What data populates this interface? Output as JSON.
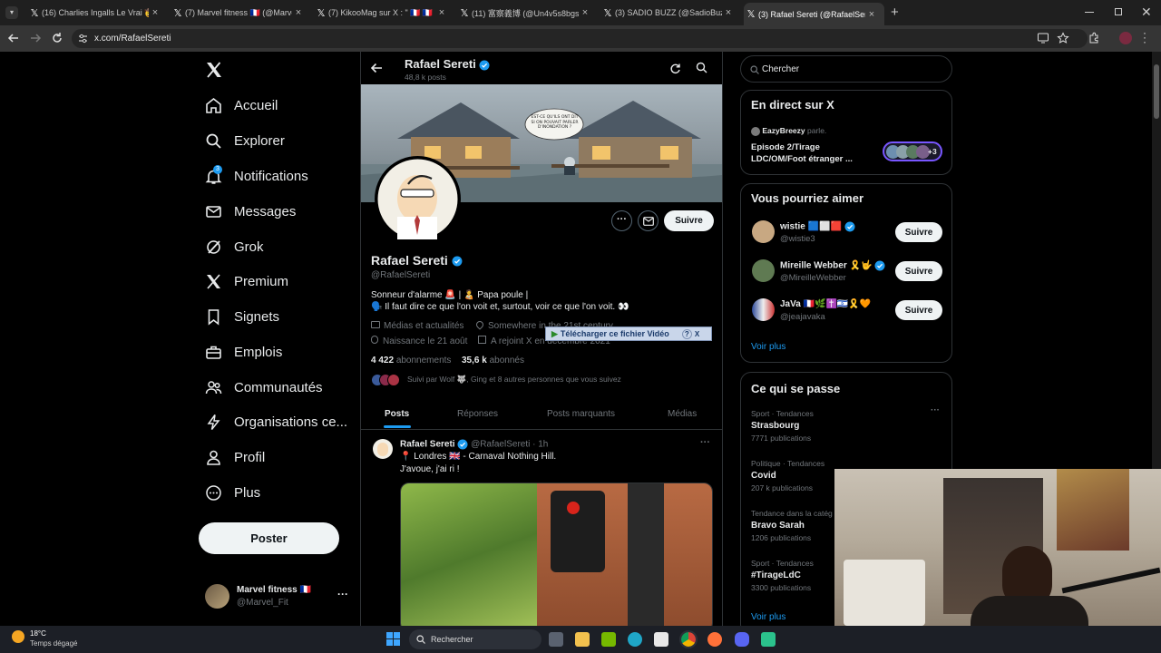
{
  "browser": {
    "tabs": [
      {
        "title": "(16) Charlies Ingalls Le Vrai 🤠 ’"
      },
      {
        "title": "(7) Marvel fitness 🇫🇷 (@Marvel_"
      },
      {
        "title": "(7) KikooMag sur X : \" 🇫🇷 🇫🇷 | U"
      },
      {
        "title": "(11) 富察義博 (@Un4v5s8bgsVI"
      },
      {
        "title": "(3) SADIO BUZZ (@SadioBuzz)"
      },
      {
        "title": "(3) Rafael Sereti (@RafaelSereti"
      }
    ],
    "url": "x.com/RafaelSereti"
  },
  "sidebar": {
    "items": [
      {
        "label": "Accueil",
        "icon": "home-icon"
      },
      {
        "label": "Explorer",
        "icon": "search-icon"
      },
      {
        "label": "Notifications",
        "icon": "bell-icon",
        "badge": "3"
      },
      {
        "label": "Messages",
        "icon": "mail-icon"
      },
      {
        "label": "Grok",
        "icon": "grok-icon"
      },
      {
        "label": "Premium",
        "icon": "x-logo-icon"
      },
      {
        "label": "Signets",
        "icon": "bookmark-icon"
      },
      {
        "label": "Emplois",
        "icon": "briefcase-icon"
      },
      {
        "label": "Communautés",
        "icon": "people-icon"
      },
      {
        "label": "Organisations ce...",
        "icon": "lightning-icon"
      },
      {
        "label": "Profil",
        "icon": "person-icon"
      },
      {
        "label": "Plus",
        "icon": "more-circle-icon"
      }
    ],
    "post_button": "Poster",
    "account": {
      "name": "Marvel fitness 🇫🇷",
      "handle": "@Marvel_Fit"
    }
  },
  "profile": {
    "header_name": "Rafael Sereti",
    "post_count": "48,8 k posts",
    "banner_bubble": "EST-CE QU'ILS ONT DIT SI ON POUVAIT PARLER D'INONDATION ?",
    "name": "Rafael Sereti",
    "handle": "@RafaelSereti",
    "bio_line1": "Sonneur d'alarme 🚨 | 🧑‍🍼 Papa poule |",
    "bio_line2": "🗣️ Il faut dire ce que l'on voit et, surtout, voir ce que l'on voit. 👀",
    "category": "Médias et actualités",
    "location": "Somewhere in the 21st century",
    "birthday": "Naissance le 21 août",
    "joined": "A rejoint X en décembre 2021",
    "following_count": "4 422",
    "following_label": "abonnements",
    "followers_count": "35,6 k",
    "followers_label": "abonnés",
    "followed_by": "Suivi par Wolf 🐺, Ging et 8 autres personnes que vous suivez",
    "follow_button": "Suivre",
    "tabs": [
      "Posts",
      "Réponses",
      "Posts marquants",
      "Médias"
    ]
  },
  "overlay": {
    "download_label": "Télécharger ce fichier Vidéo",
    "help": "?",
    "close": "X"
  },
  "post": {
    "author": "Rafael Sereti",
    "handle": "@RafaelSereti",
    "time": "· 1h",
    "line1": "📍 Londres 🇬🇧 - Carnaval Nothing Hill.",
    "line2": "J'avoue, j'ai ri !"
  },
  "right": {
    "search_placeholder": "Chercher",
    "live": {
      "title": "En direct sur X",
      "host": "EazyBreezy",
      "host_suffix": "parle.",
      "event": "Episode 2/Tirage LDC/OM/Foot étranger ...",
      "plus": "+3"
    },
    "suggestions": {
      "title": "Vous pourriez aimer",
      "users": [
        {
          "name": "wistie 🟦⬜🟥",
          "handle": "@wistie3",
          "button": "Suivre"
        },
        {
          "name": "Mireille Webber 🎗️🤟",
          "handle": "@MireilleWebber",
          "button": "Suivre"
        },
        {
          "name": "JaVa 🇫🇷🌿✝️🇮🇱🎗️🧡",
          "handle": "@jeajavaka",
          "button": "Suivre"
        }
      ],
      "more": "Voir plus"
    },
    "trends": {
      "title": "Ce qui se passe",
      "items": [
        {
          "category": "Sport · Tendances",
          "name": "Strasbourg",
          "count": "7771 publications"
        },
        {
          "category": "Politique · Tendances",
          "name": "Covid",
          "count": "207 k publications"
        },
        {
          "category": "Tendance dans la catég",
          "name": "Bravo Sarah",
          "count": "1206 publications"
        },
        {
          "category": "Sport · Tendances",
          "name": "#TirageLdC",
          "count": "3300 publications"
        }
      ],
      "more": "Voir plus"
    }
  },
  "taskbar": {
    "weather_temp": "18°C",
    "weather_desc": "Temps dégagé",
    "search": "Rechercher"
  }
}
